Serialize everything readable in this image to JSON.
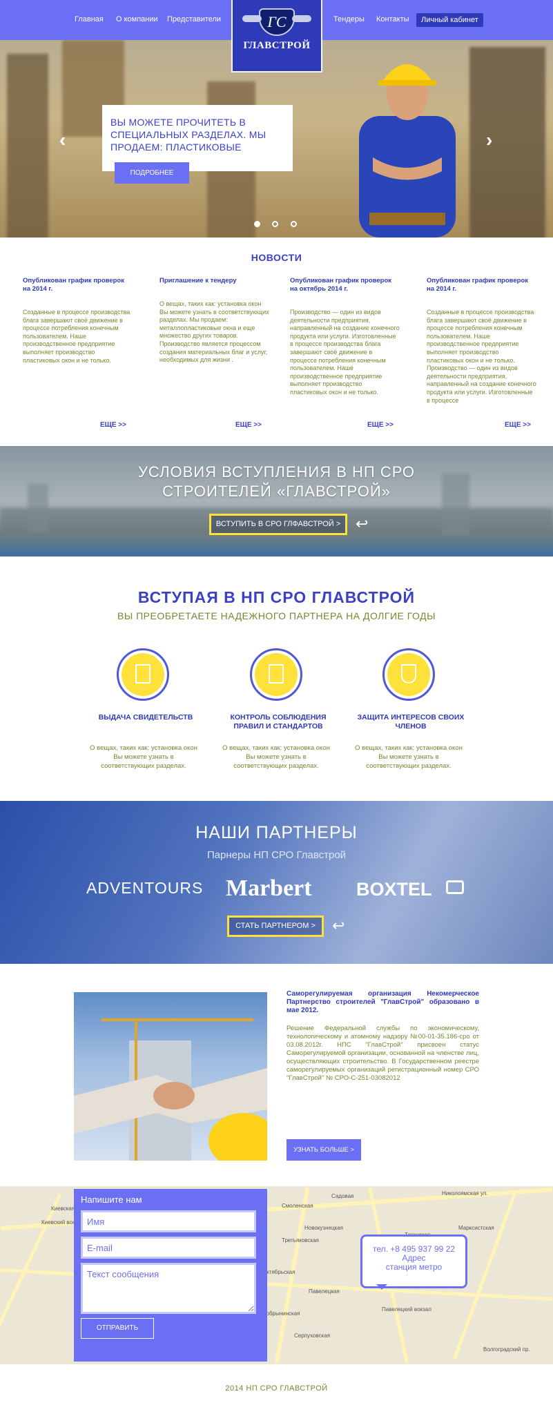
{
  "nav": {
    "items": [
      "Главная",
      "О компании",
      "Представители",
      "Тендеры",
      "Контакты"
    ],
    "cabinet": "Личный кабинет",
    "logo_text": "ГЛАВСТРОЙ",
    "logo_monogram": "ГС"
  },
  "hero": {
    "text": "ВЫ МОЖЕТЕ ПРОЧИТЕТЬ В СПЕЦИАЛЬНЫХ РАЗДЕЛАХ. МЫ ПРОДАЕМ: ПЛАСТИКОВЫЕ",
    "button": "ПОДРОБНЕЕ",
    "prev": "‹",
    "next": "›",
    "slides": 3,
    "active_slide": 1
  },
  "news": {
    "title": "НОВОСТИ",
    "more": "ЕЩЕ >>",
    "items": [
      {
        "title": "Опубликован график проверок на 2014 г.",
        "text": "Созданные в процессе производства блага завершают своё движение в процессе потребления конечным пользователем. Наше производственное предприятие выполняет производство пластиковых окон и не только."
      },
      {
        "title": "Приглашение к тендеру",
        "text": "О вещах, таких как: установка окон Вы можете узнать в соответствующих разделах. Мы продаем: металлопластиковые окна и еще множество других товаров. Производство является процессом создания материальных благ и услуг, необходимых для жизни ."
      },
      {
        "title": "Опубликован график проверок на октябрь 2014 г.",
        "text": "Производство — один из видов деятельности предприятия, направленный на создание конечного продукта или услуги. Изготовленные в процессе производства блага завершают своё движение в процессе потребления конечным пользователем. Наше производственное предприятие выполняет производство пластиковых окон и не только."
      },
      {
        "title": "Опубликован график проверок на 2014 г.",
        "text": "Созданные в процессе производства блага завершают своё движение в процессе потребления конечным пользователем. Наше производственное предприятие выполняет производство пластиковых окон и не только. Производство — один из видов деятельности предприятия, направленный на создание конечного продукта или услуги. Изготовленные в процессе"
      }
    ]
  },
  "join_band": {
    "title_line1": "УСЛОВИЯ ВСТУПЛЕНИЯ В НП СРО",
    "title_line2": "СТРОИТЕЛЕЙ «ГЛАВСТРОЙ»",
    "button": "ВСТУПИТЬ В СРО ГЛФАВСТРОЙ >"
  },
  "benefits": {
    "title": "ВСТУПАЯ В НП СРО ГЛАВСТРОЙ",
    "subtitle": "ВЫ ПРЕОБРЕТАЕТЕ НАДЕЖНОГО ПАРТНЕРА НА ДОЛГИЕ ГОДЫ",
    "items": [
      {
        "title": "ВЫДАЧА СВИДЕТЕЛЬСТВ",
        "text": "О вещах, таких как: установка окон Вы можете узнать в соответствующих разделах.",
        "icon": "certificate-icon"
      },
      {
        "title": "КОНТРОЛЬ СОБЛЮДЕНИЯ ПРАВИЛ И СТАНДАРТОВ",
        "text": "О вещах, таких как: установка окон Вы можете узнать в соответствующих разделах.",
        "icon": "checklist-icon"
      },
      {
        "title": "ЗАЩИТА ИНТЕРЕСОВ СВОИХ ЧЛЕНОВ",
        "text": "О вещах, таких как: установка окон Вы можете узнать в соответствующих разделах.",
        "icon": "shield-icon"
      }
    ]
  },
  "partners": {
    "title": "НАШИ ПАРТНЕРЫ",
    "subtitle": "Парнеры НП СРО Главстрой",
    "logos": [
      "ADVENTOURS",
      "Marbert",
      "BOXTEL"
    ],
    "button": "СТАТЬ ПАРТНЕРОМ >"
  },
  "about": {
    "heading": "Саморегулируемая организация Некомерческое Партнерство строителей \"ГлавСтрой\" образовано в мае 2012.",
    "text": "Решение Федеральной службы по экономическому, технологическому и атомному надзору №00-01-35.186-сро от 03.08.2012г. НПС \"ГлавСтрой\" присвоен статус Саморегулируемой организации, основанной на членстве лиц, осуществляющих строительство. В Государственном реестре саморегулируемых организаций регистрационный номер СРО \"ГлавСтрой\" № СРО-С-251-03082012",
    "button": "УЗНАТЬ БОЛЬШЕ >"
  },
  "contact": {
    "title": "Напишите нам",
    "name_placeholder": "Имя",
    "email_placeholder": "E-mail",
    "message_placeholder": "Текст сообщения",
    "send": "ОТПРАВИТЬ",
    "phone": "тел. +8 495 937 99 22",
    "address": "Адрес",
    "metro": "станция метро"
  },
  "map_labels": [
    "Киевская",
    "Киевский вокзал",
    "Смоленская",
    "Новокузнецкая",
    "Третьяковская",
    "Таганская",
    "Марксистская",
    "Павелецкая",
    "Павелецкий вокзал",
    "Серпуховская",
    "Николоямская ул.",
    "Садовая",
    "Октябрьская",
    "Добрынинская",
    "Волгоградский пр."
  ],
  "footer": "2014 НП СРО ГЛАВСТРОЙ"
}
